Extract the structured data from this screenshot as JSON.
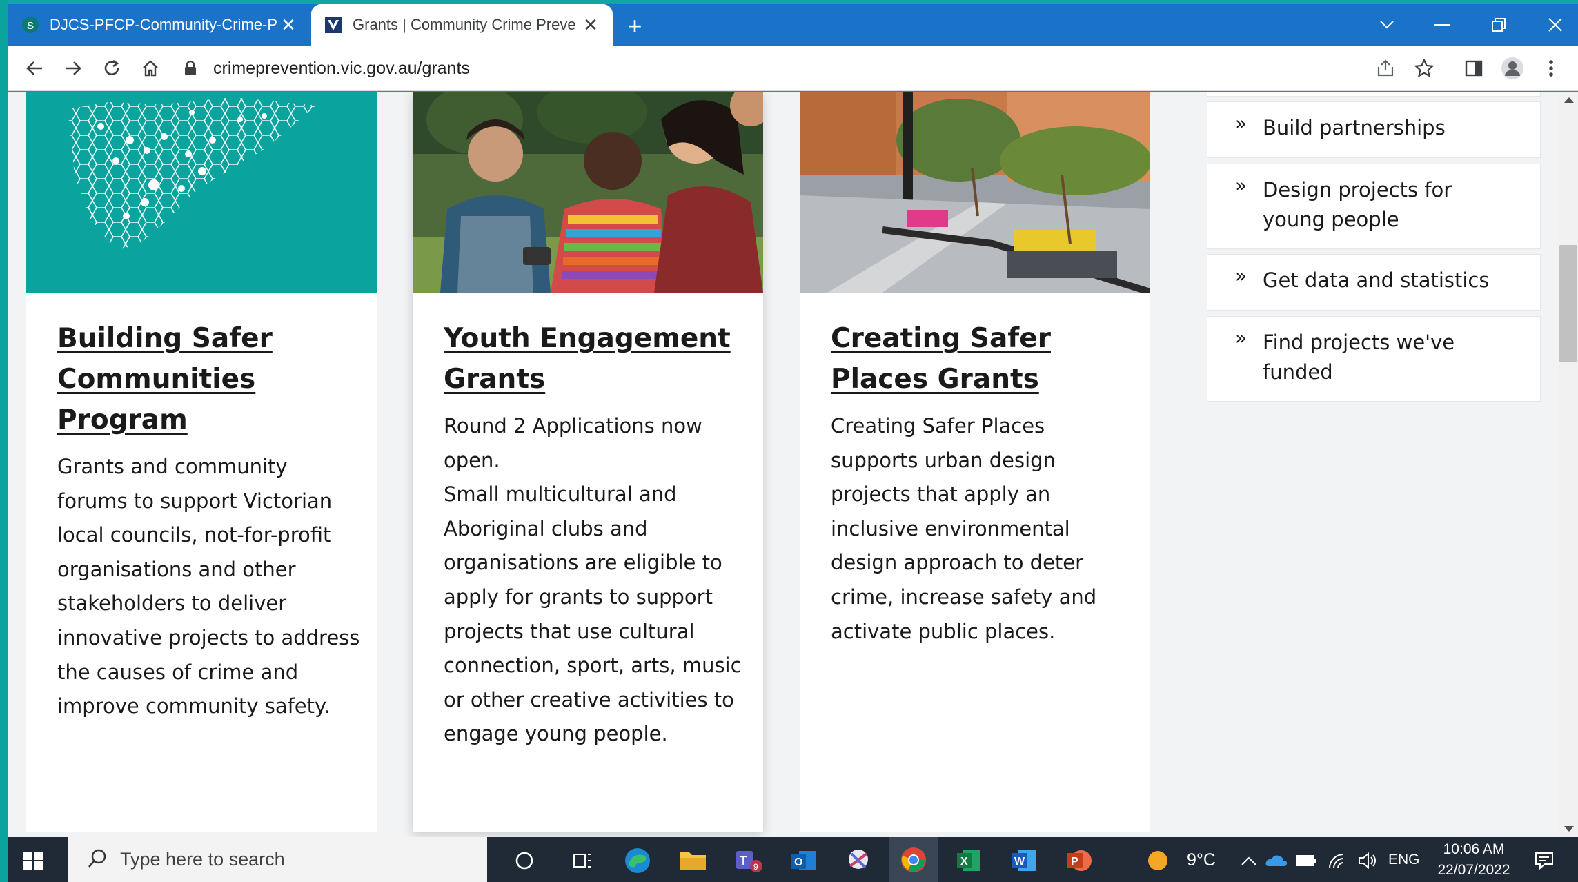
{
  "browser": {
    "tabs": [
      {
        "title": "DJCS-PFCP-Community-Crime-P",
        "active": false
      },
      {
        "title": "Grants | Community Crime Preve",
        "active": true
      }
    ],
    "url": "crimeprevention.vic.gov.au/grants"
  },
  "cards": [
    {
      "title": "Building Safer Communities Program",
      "description": "Grants and community forums to support Victorian local councils, not-for-profit organisations and other stakeholders to deliver innovative projects to address the causes of crime and improve community safety."
    },
    {
      "title": "Youth Engagement Grants",
      "description": "Round 2 Applications now open.\nSmall multicultural and Aboriginal clubs and organisations are eligible to apply for grants to support projects that use cultural connection, sport, arts, music or other creative activities to engage young people."
    },
    {
      "title": "Creating Safer Places Grants",
      "description": "Creating Safer Places supports urban design projects that apply an inclusive environmental design approach to deter crime, increase safety and activate public places."
    }
  ],
  "sidebar": {
    "links": [
      {
        "label": "Build partnerships"
      },
      {
        "label": "Design projects for young people"
      },
      {
        "label": "Get data and statistics"
      },
      {
        "label": "Find projects we've funded"
      }
    ]
  },
  "taskbar": {
    "search_placeholder": "Type here to search",
    "weather": "9°C",
    "language": "ENG",
    "time": "10:06 AM",
    "date": "22/07/2022"
  },
  "colors": {
    "tabstrip": "#1a73c8",
    "accent_teal": "#0aa39d",
    "text": "#1a1a1a",
    "taskbar": "#1f2a36"
  }
}
